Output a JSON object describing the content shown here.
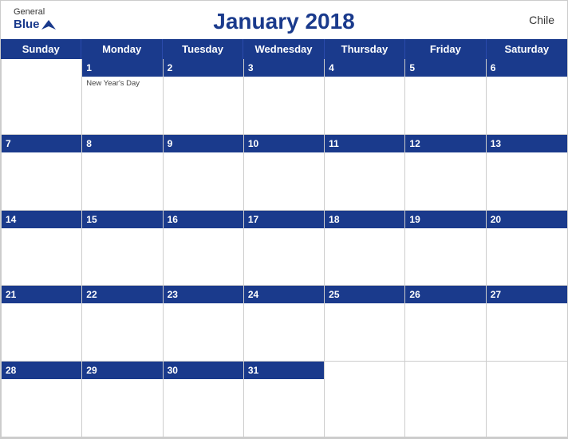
{
  "header": {
    "logo": {
      "general": "General",
      "blue": "Blue",
      "bird_unicode": "▲"
    },
    "title": "January 2018",
    "country": "Chile"
  },
  "days": [
    "Sunday",
    "Monday",
    "Tuesday",
    "Wednesday",
    "Thursday",
    "Friday",
    "Saturday"
  ],
  "weeks": [
    [
      {
        "day": "",
        "empty": true
      },
      {
        "day": "1",
        "holiday": "New Year's Day"
      },
      {
        "day": "2"
      },
      {
        "day": "3"
      },
      {
        "day": "4"
      },
      {
        "day": "5"
      },
      {
        "day": "6"
      }
    ],
    [
      {
        "day": "7"
      },
      {
        "day": "8"
      },
      {
        "day": "9"
      },
      {
        "day": "10"
      },
      {
        "day": "11"
      },
      {
        "day": "12"
      },
      {
        "day": "13"
      }
    ],
    [
      {
        "day": "14"
      },
      {
        "day": "15"
      },
      {
        "day": "16"
      },
      {
        "day": "17"
      },
      {
        "day": "18"
      },
      {
        "day": "19"
      },
      {
        "day": "20"
      }
    ],
    [
      {
        "day": "21"
      },
      {
        "day": "22"
      },
      {
        "day": "23"
      },
      {
        "day": "24"
      },
      {
        "day": "25"
      },
      {
        "day": "26"
      },
      {
        "day": "27"
      }
    ],
    [
      {
        "day": "28"
      },
      {
        "day": "29"
      },
      {
        "day": "30"
      },
      {
        "day": "31"
      },
      {
        "day": "",
        "empty": true
      },
      {
        "day": "",
        "empty": true
      },
      {
        "day": "",
        "empty": true
      }
    ]
  ],
  "colors": {
    "header_bg": "#1a3a8c",
    "header_text": "#ffffff",
    "title": "#1a3a8c",
    "cell_border": "#cccccc"
  }
}
